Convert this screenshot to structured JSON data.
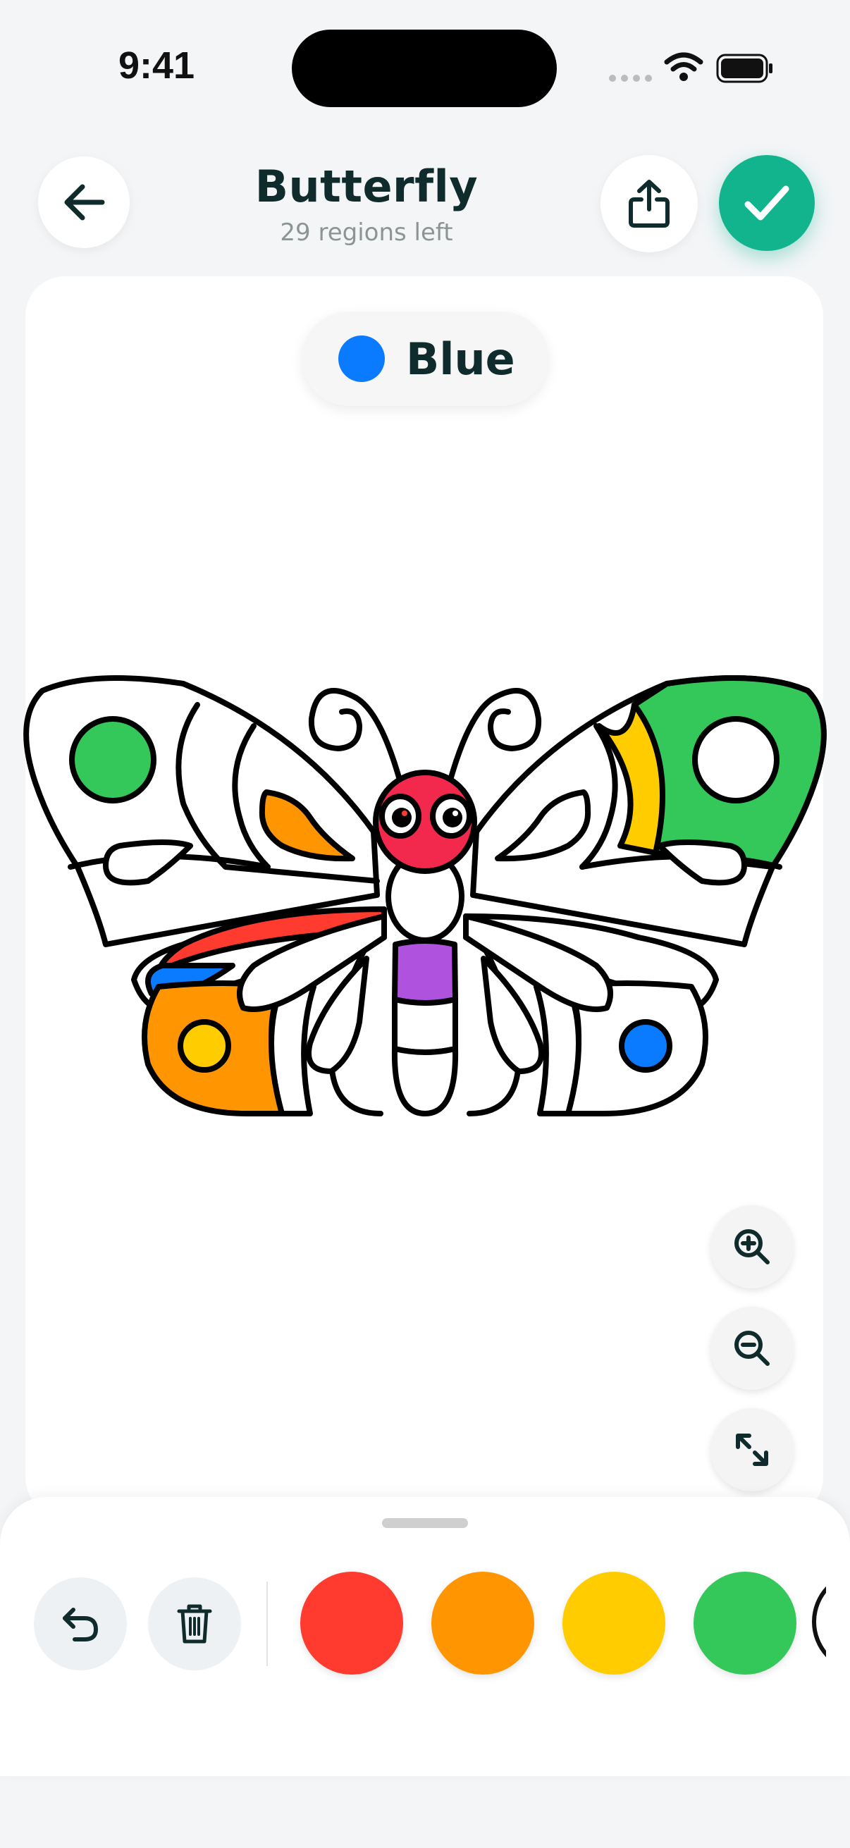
{
  "status": {
    "time": "9:41"
  },
  "header": {
    "title": "Butterfly",
    "subtitle": "29 regions left",
    "back_icon": "arrow-left-icon",
    "share_icon": "share-icon",
    "done_icon": "checkmark-icon"
  },
  "current_color": {
    "label": "Blue",
    "hex": "#0a7bff"
  },
  "zoom_controls": [
    "zoom-in-icon",
    "zoom-out-icon",
    "fit-screen-icon"
  ],
  "toolbar": {
    "undo_icon": "undo-icon",
    "clear_icon": "trash-icon"
  },
  "palette": [
    {
      "name": "red",
      "hex": "#ff3b30"
    },
    {
      "name": "orange",
      "hex": "#ff9500"
    },
    {
      "name": "yellow",
      "hex": "#ffcc00"
    },
    {
      "name": "green",
      "hex": "#34c759"
    }
  ],
  "colors": {
    "accent": "#12b48d",
    "background": "#f3f5f7"
  }
}
